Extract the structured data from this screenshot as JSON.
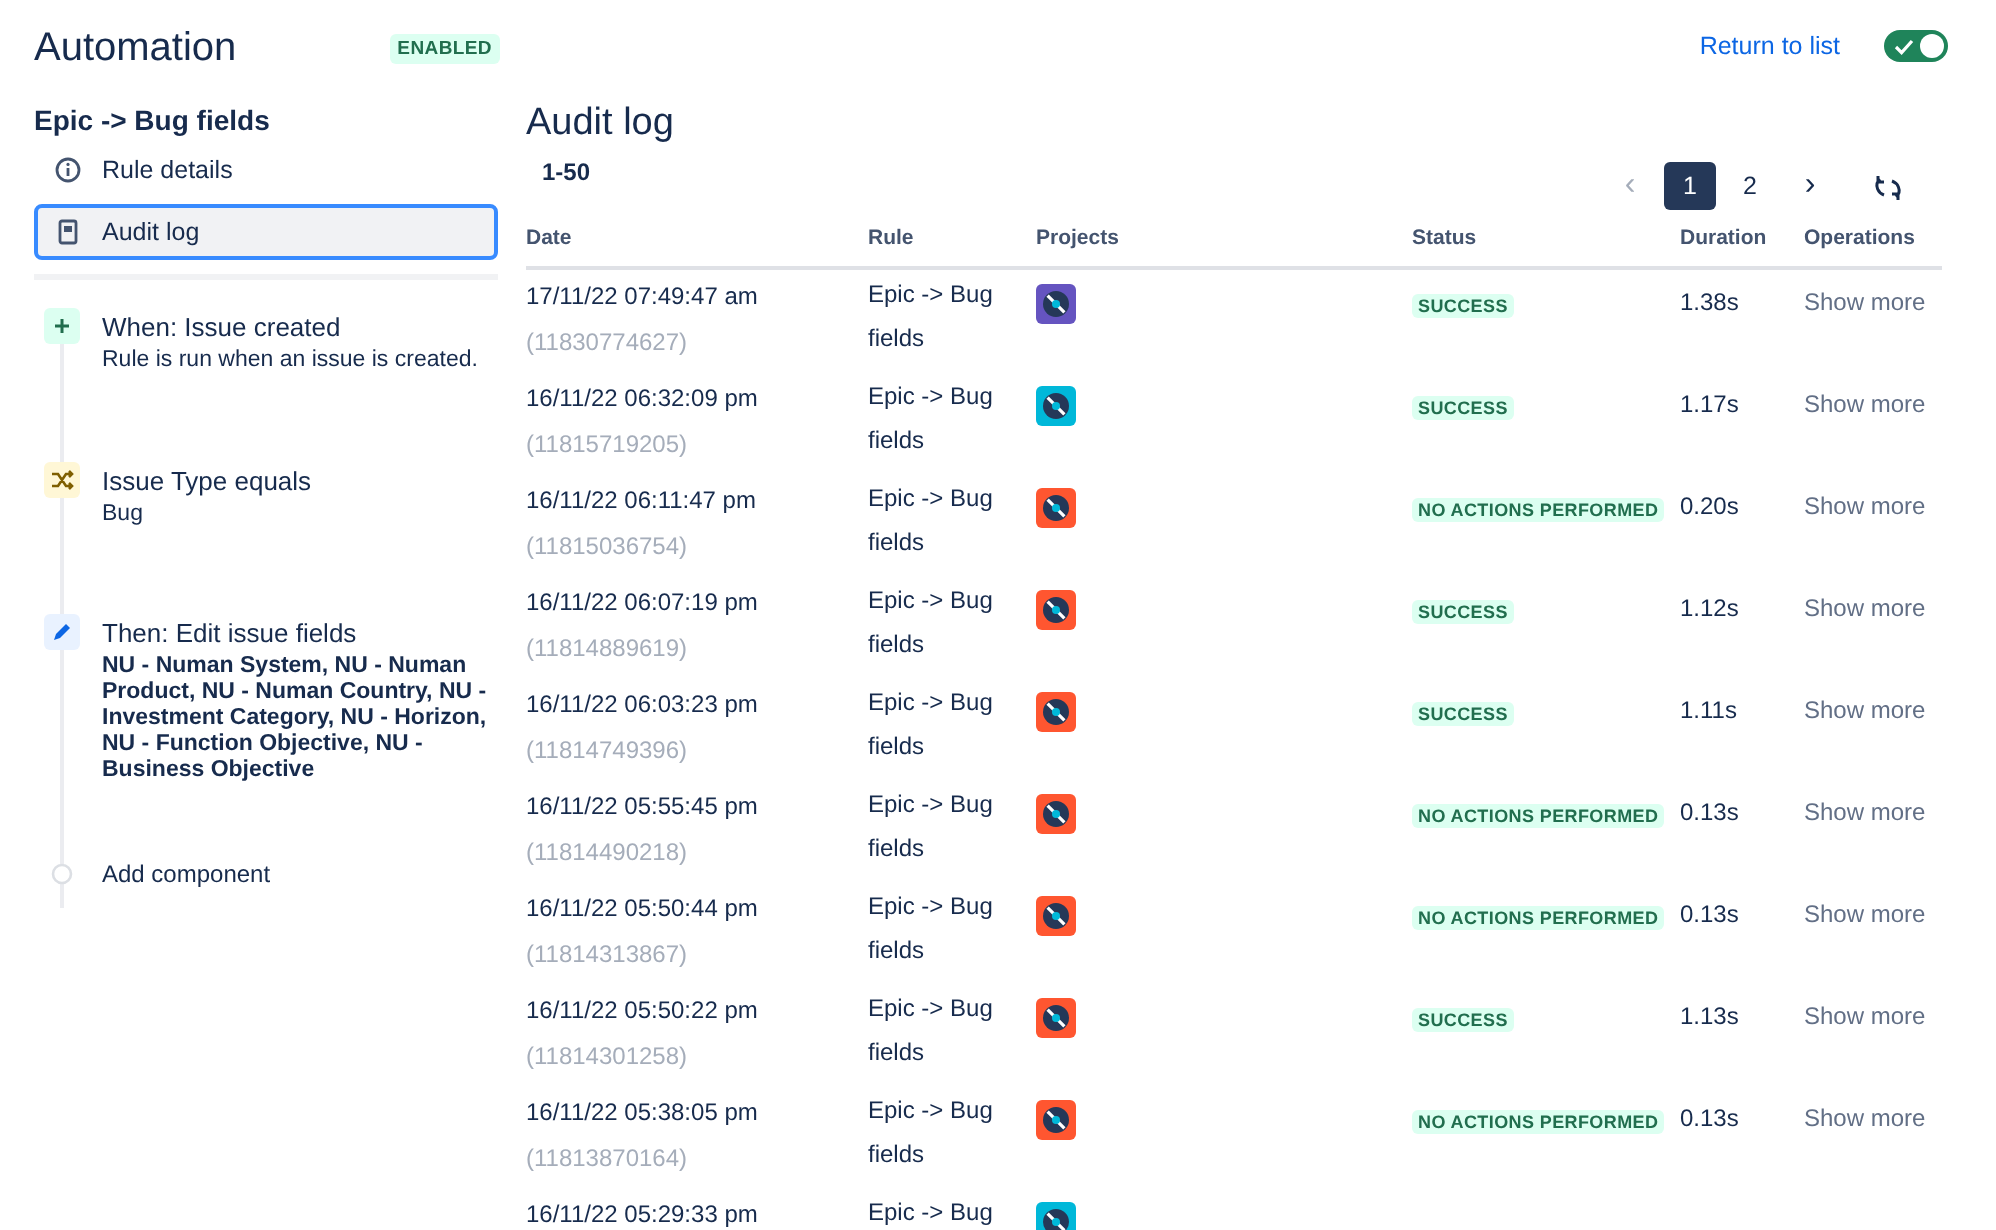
{
  "header": {
    "title": "Automation",
    "badge": "ENABLED",
    "return_link": "Return to list",
    "toggle": {
      "on": true
    }
  },
  "sidebar": {
    "rule_name": "Epic -> Bug fields",
    "nav": [
      {
        "label": "Rule details",
        "selected": false
      },
      {
        "label": "Audit log",
        "selected": true
      }
    ],
    "steps": [
      {
        "kind": "trigger",
        "title": "When: Issue created",
        "detail": "Rule is run when an issue is created."
      },
      {
        "kind": "condition",
        "title": "Issue Type equals",
        "detail": "Bug"
      },
      {
        "kind": "action",
        "title": "Then: Edit issue fields",
        "detail": "NU - Numan System, NU - Numan Product, NU - Numan Country, NU - Investment Category, NU - Horizon, NU - Function Objective, NU - Business Objective"
      },
      {
        "kind": "add",
        "title": "Add component"
      }
    ]
  },
  "audit": {
    "title": "Audit log",
    "range": "1-50",
    "pagination": {
      "prev": "‹",
      "next": "›",
      "pages": [
        {
          "label": "1",
          "selected": true
        },
        {
          "label": "2",
          "selected": false
        }
      ]
    },
    "columns": [
      "Date",
      "Rule",
      "Projects",
      "Status",
      "Duration",
      "Operations"
    ],
    "rows": [
      {
        "date": "17/11/22 07:49:47 am",
        "id": "(11830774627)",
        "rule": "Epic -> Bug fields",
        "color": "#6554c0",
        "status": "SUCCESS",
        "duration": "1.38s",
        "operation": "Show more"
      },
      {
        "date": "16/11/22 06:32:09 pm",
        "id": "(11815719205)",
        "rule": "Epic -> Bug fields",
        "color": "#00b8d9",
        "status": "SUCCESS",
        "duration": "1.17s",
        "operation": "Show more"
      },
      {
        "date": "16/11/22 06:11:47 pm",
        "id": "(11815036754)",
        "rule": "Epic -> Bug fields",
        "color": "#ff5630",
        "status": "NO ACTIONS PERFORMED",
        "duration": "0.20s",
        "operation": "Show more"
      },
      {
        "date": "16/11/22 06:07:19 pm",
        "id": "(11814889619)",
        "rule": "Epic -> Bug fields",
        "color": "#ff5630",
        "status": "SUCCESS",
        "duration": "1.12s",
        "operation": "Show more"
      },
      {
        "date": "16/11/22 06:03:23 pm",
        "id": "(11814749396)",
        "rule": "Epic -> Bug fields",
        "color": "#ff5630",
        "status": "SUCCESS",
        "duration": "1.11s",
        "operation": "Show more"
      },
      {
        "date": "16/11/22 05:55:45 pm",
        "id": "(11814490218)",
        "rule": "Epic -> Bug fields",
        "color": "#ff5630",
        "status": "NO ACTIONS PERFORMED",
        "duration": "0.13s",
        "operation": "Show more"
      },
      {
        "date": "16/11/22 05:50:44 pm",
        "id": "(11814313867)",
        "rule": "Epic -> Bug fields",
        "color": "#ff5630",
        "status": "NO ACTIONS PERFORMED",
        "duration": "0.13s",
        "operation": "Show more"
      },
      {
        "date": "16/11/22 05:50:22 pm",
        "id": "(11814301258)",
        "rule": "Epic -> Bug fields",
        "color": "#ff5630",
        "status": "SUCCESS",
        "duration": "1.13s",
        "operation": "Show more"
      },
      {
        "date": "16/11/22 05:38:05 pm",
        "id": "(11813870164)",
        "rule": "Epic -> Bug fields",
        "color": "#ff5630",
        "status": "NO ACTIONS PERFORMED",
        "duration": "0.13s",
        "operation": "Show more"
      },
      {
        "date": "16/11/22 05:29:33 pm",
        "rule": "Epic -> Bug",
        "color": "#00b8d9"
      }
    ]
  }
}
